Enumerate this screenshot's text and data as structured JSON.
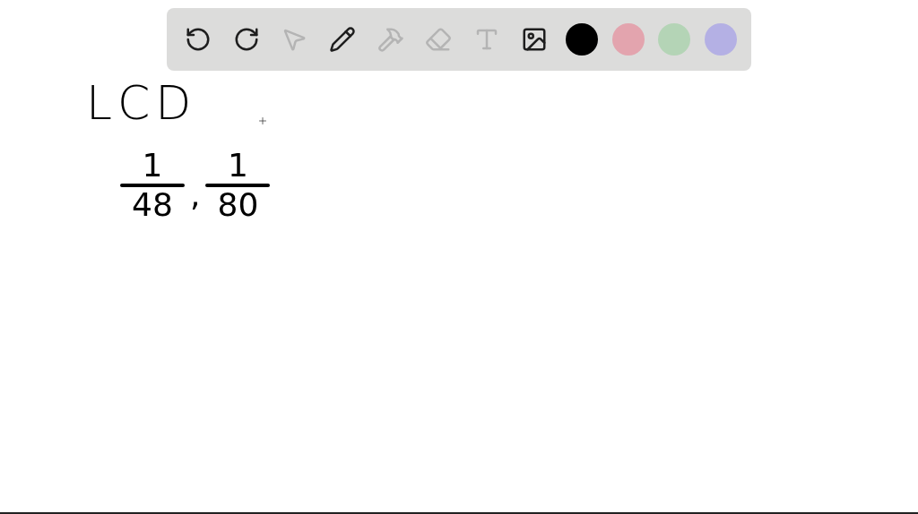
{
  "toolbar": {
    "tools": [
      {
        "kind": "undo",
        "disabled": false
      },
      {
        "kind": "redo",
        "disabled": false
      },
      {
        "kind": "select",
        "disabled": true
      },
      {
        "kind": "pen",
        "disabled": false
      },
      {
        "kind": "tools",
        "disabled": true
      },
      {
        "kind": "eraser",
        "disabled": true
      },
      {
        "kind": "text",
        "disabled": true
      },
      {
        "kind": "image",
        "disabled": false
      }
    ],
    "colors": [
      {
        "color": "#000000"
      },
      {
        "color": "#e3a4ae"
      },
      {
        "color": "#b4d4b6"
      },
      {
        "color": "#b4b0e4"
      }
    ]
  },
  "canvas": {
    "heading": "LCD",
    "fractions": [
      {
        "numerator": "1",
        "denominator": "48"
      },
      {
        "numerator": "1",
        "denominator": "80"
      }
    ],
    "separator": ","
  }
}
